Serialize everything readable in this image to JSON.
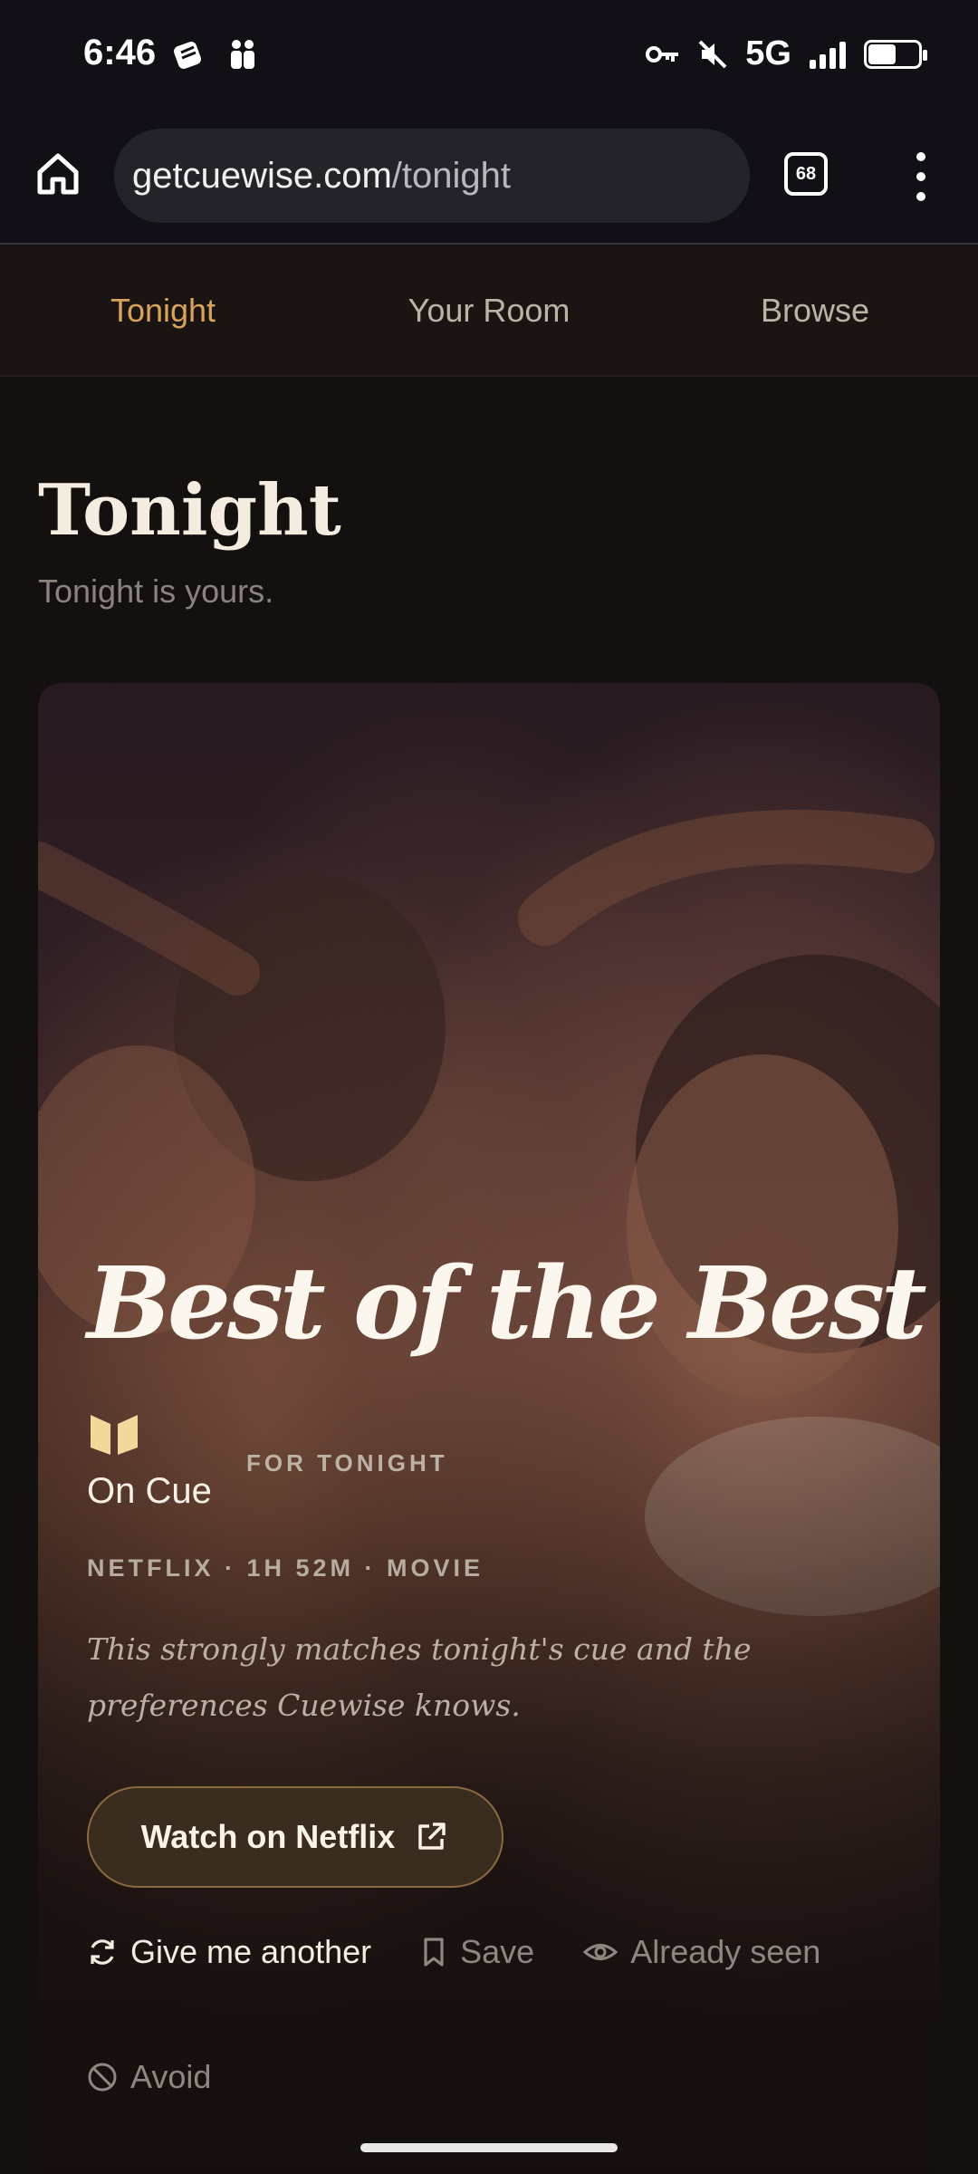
{
  "status_bar": {
    "time": "6:46",
    "network": "5G",
    "icons": [
      "notification-app-icon",
      "people-icon",
      "vpn-key-icon",
      "mute-icon",
      "signal-icon",
      "battery-icon"
    ]
  },
  "browser": {
    "url_host": "getcuewise.com",
    "url_path": "/tonight",
    "tab_count": "68"
  },
  "nav": {
    "items": [
      {
        "label": "Tonight",
        "active": true
      },
      {
        "label": "Your Room",
        "active": false
      },
      {
        "label": "Browse",
        "active": false
      }
    ]
  },
  "page": {
    "title": "Tonight",
    "subtitle": "Tonight is yours."
  },
  "card": {
    "title": "Best of the Best",
    "badge": "On Cue",
    "tag": "FOR TONIGHT",
    "meta": "NETFLIX · 1H 52M · MOVIE",
    "blurb": "This strongly matches tonight's cue and the preferences Cuewise knows.",
    "watch_label": "Watch on Netflix",
    "actions": {
      "another": "Give me another",
      "save": "Save",
      "seen": "Already seen",
      "avoid": "Avoid"
    }
  },
  "colors": {
    "accent": "#d9a35c",
    "background": "#151010"
  }
}
